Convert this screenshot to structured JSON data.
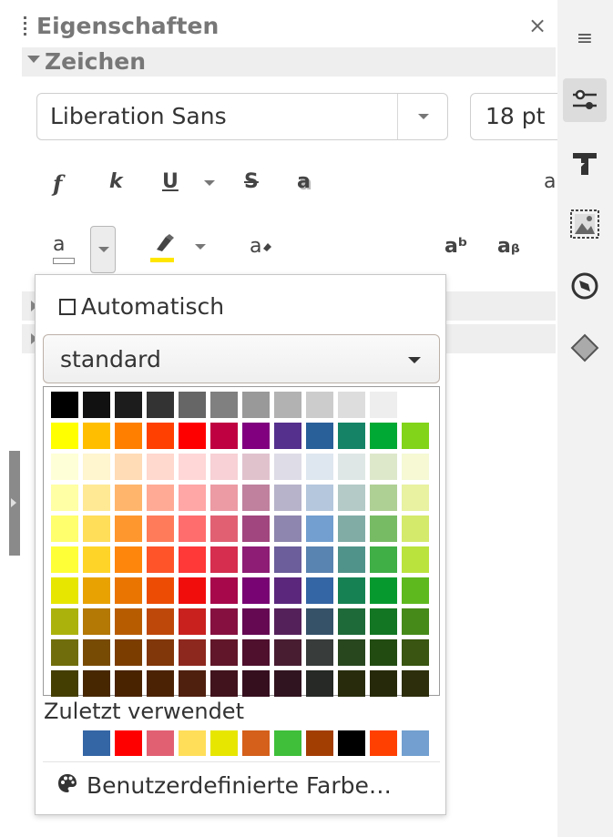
{
  "panel": {
    "title": "Eigenschaften",
    "close_glyph": "×",
    "section_label": "Zeichen"
  },
  "font": {
    "name": "Liberation Sans",
    "size": "18 pt"
  },
  "toolbar": {
    "bold_glyph": "f",
    "italic_glyph": "k",
    "underline_glyph": "U",
    "strike_glyph": "S",
    "shadow_glyph": "a",
    "cut_glyph": "a",
    "font_color_glyph": "a",
    "clear_glyph": "a",
    "superscript_glyph": "aᵇ",
    "subscript_glyph": "aᵦ"
  },
  "tabbar": {
    "menu_glyph": "≡",
    "icons": [
      "properties-icon",
      "styles-icon",
      "gallery-icon",
      "navigator-icon",
      "shapes-icon"
    ]
  },
  "popup": {
    "automatic_label": "Automatisch",
    "palette_name": "standard",
    "recent_label": "Zuletzt verwendet",
    "custom_label": "Benutzerdefinierte Farbe…",
    "palette": [
      [
        "#000000",
        "#111111",
        "#1c1c1c",
        "#333333",
        "#666666",
        "#808080",
        "#999999",
        "#b2b2b2",
        "#cccccc",
        "#dddddd",
        "#eeeeee",
        "#ffffff"
      ],
      [
        "#ffff00",
        "#ffbf00",
        "#ff8000",
        "#ff4000",
        "#ff0000",
        "#bf0041",
        "#800080",
        "#55308d",
        "#2a6099",
        "#158466",
        "#00a933",
        "#81d41a"
      ],
      [
        "#ffffd7",
        "#fff5ce",
        "#ffdbb6",
        "#ffd8ce",
        "#ffd7d7",
        "#f7d1d5",
        "#e0c2cd",
        "#dedce6",
        "#dee6ef",
        "#dee7e5",
        "#dde8cb",
        "#f6f9d4"
      ],
      [
        "#ffffa6",
        "#ffe994",
        "#ffb66c",
        "#ffaa95",
        "#ffa6a6",
        "#ec9ba4",
        "#bf819e",
        "#b7b3ca",
        "#b4c7dc",
        "#b3cac7",
        "#afd095",
        "#e8f2a1"
      ],
      [
        "#ffff6d",
        "#ffde59",
        "#ff972f",
        "#ff7b59",
        "#ff6d6d",
        "#e16173",
        "#a1467e",
        "#8e86ae",
        "#729fcf",
        "#81aca6",
        "#77bc65",
        "#d4ea6b"
      ],
      [
        "#ffff38",
        "#ffd428",
        "#ff860d",
        "#ff5429",
        "#ff3838",
        "#d62e4e",
        "#8d1d75",
        "#6b5e9b",
        "#5983b0",
        "#50938a",
        "#3faf46",
        "#bbe33d"
      ],
      [
        "#e6e600",
        "#e8a202",
        "#ea7500",
        "#ed4c05",
        "#f10d0c",
        "#a7074b",
        "#780373",
        "#5b277d",
        "#3465a4",
        "#168253",
        "#069a2e",
        "#5eb91e"
      ],
      [
        "#acb20c",
        "#b47804",
        "#b85c00",
        "#be480a",
        "#c9211e",
        "#861141",
        "#650953",
        "#55215b",
        "#355269",
        "#1e6a39",
        "#127622",
        "#468a1a"
      ],
      [
        "#706e0c",
        "#784b04",
        "#7b3d00",
        "#813709",
        "#8d281e",
        "#611729",
        "#4e102d",
        "#481d32",
        "#383d3c",
        "#28471f",
        "#224b12",
        "#395511"
      ],
      [
        "#443e02",
        "#472702",
        "#492300",
        "#4b2204",
        "#50200f",
        "#41131d",
        "#360f1f",
        "#30141f",
        "#262925",
        "#282c0c",
        "#272a0a",
        "#2d2e0c"
      ]
    ],
    "recent": [
      "#3465a4",
      "#ff0000",
      "#e16173",
      "#ffde59",
      "#e6e600",
      "#d4601b",
      "#3fbf3a",
      "#a33e03",
      "#000000",
      "#ff4000",
      "#729fcf"
    ]
  }
}
